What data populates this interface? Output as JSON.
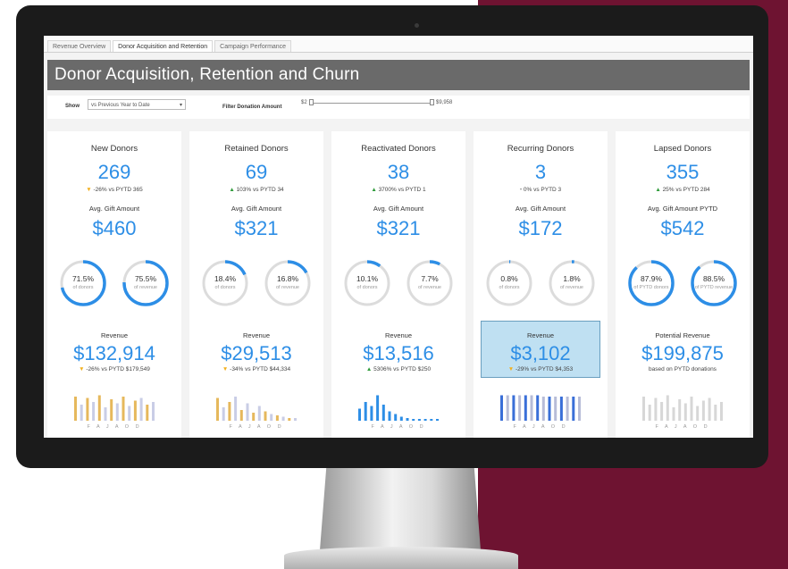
{
  "tabs": [
    "Revenue Overview",
    "Donor Acquisition and Retention",
    "Campaign Performance"
  ],
  "active_tab": 1,
  "header": {
    "title": "Donor Acquisition, Retention and Churn"
  },
  "filters": {
    "show_label": "Show",
    "show_value": "vs Previous Year to Date",
    "amount_label": "Filter Donation Amount",
    "amount_min": "$2",
    "amount_max": "$9,958"
  },
  "months": "F A J A O D",
  "colors": {
    "accent": "#2d8ee6",
    "up": "#2e9b3a",
    "down": "#f2b01e",
    "header": "#6a6a6a",
    "highlight": "#bfe0f2"
  },
  "cards": [
    {
      "title": "New Donors",
      "count": "269",
      "delta": {
        "dir": "down",
        "text": "-26% vs PYTD 365"
      },
      "gift_label": "Avg. Gift Amount",
      "gift": "$460",
      "donuts": [
        {
          "pct": 71.5,
          "value": "71.5%",
          "sub": "of donors"
        },
        {
          "pct": 75.5,
          "value": "75.5%",
          "sub": "of revenue"
        }
      ],
      "rev_label": "Revenue",
      "revenue": "$132,914",
      "rev_delta": {
        "dir": "down",
        "text": "-26% vs PYTD $179,549"
      },
      "bars": [
        0.9,
        0.6,
        0.85,
        0.7,
        0.95,
        0.5,
        0.8,
        0.65,
        0.9,
        0.55,
        0.75,
        0.85,
        0.6,
        0.7
      ],
      "bar_color": "#e6b85c",
      "bar_color2": "#c9cde6",
      "highlight": false
    },
    {
      "title": "Retained Donors",
      "count": "69",
      "delta": {
        "dir": "up",
        "text": "103% vs PYTD 34"
      },
      "gift_label": "Avg. Gift Amount",
      "gift": "$321",
      "donuts": [
        {
          "pct": 18.4,
          "value": "18.4%",
          "sub": "of donors"
        },
        {
          "pct": 16.8,
          "value": "16.8%",
          "sub": "of revenue"
        }
      ],
      "rev_label": "Revenue",
      "revenue": "$29,513",
      "rev_delta": {
        "dir": "down",
        "text": "-34% vs PYTD $44,334"
      },
      "bars": [
        0.85,
        0.5,
        0.7,
        0.9,
        0.4,
        0.65,
        0.3,
        0.55,
        0.35,
        0.25,
        0.2,
        0.15,
        0.1,
        0.1
      ],
      "bar_color": "#e6b85c",
      "bar_color2": "#c9cde6",
      "highlight": false
    },
    {
      "title": "Reactivated Donors",
      "count": "38",
      "delta": {
        "dir": "up",
        "text": "3700% vs PYTD 1"
      },
      "gift_label": "Avg. Gift Amount",
      "gift": "$321",
      "donuts": [
        {
          "pct": 10.1,
          "value": "10.1%",
          "sub": "of donors"
        },
        {
          "pct": 7.7,
          "value": "7.7%",
          "sub": "of revenue"
        }
      ],
      "rev_label": "Revenue",
      "revenue": "$13,516",
      "rev_delta": {
        "dir": "up",
        "text": "5306% vs PYTD $250"
      },
      "bars": [
        0.45,
        0.7,
        0.55,
        0.95,
        0.6,
        0.35,
        0.25,
        0.15,
        0.1,
        0.05,
        0.05,
        0.05,
        0.05,
        0.05
      ],
      "bar_color": "#2d8ee6",
      "bar_color2": "#2d8ee6",
      "highlight": false
    },
    {
      "title": "Recurring Donors",
      "count": "3",
      "delta": {
        "dir": "neu",
        "text": "0% vs PYTD 3"
      },
      "gift_label": "Avg. Gift Amount",
      "gift": "$172",
      "donuts": [
        {
          "pct": 0.8,
          "value": "0.8%",
          "sub": "of donors"
        },
        {
          "pct": 1.8,
          "value": "1.8%",
          "sub": "of revenue"
        }
      ],
      "rev_label": "Revenue",
      "revenue": "$3,102",
      "rev_delta": {
        "dir": "down",
        "text": "-29% vs PYTD $4,353"
      },
      "bars": [
        0.95,
        0.95,
        0.95,
        0.95,
        0.95,
        0.95,
        0.95,
        0.9,
        0.9,
        0.9,
        0.9,
        0.9,
        0.9,
        0.9
      ],
      "bar_color": "#3a6fd8",
      "bar_color2": "#b7bcd8",
      "highlight": true
    },
    {
      "title": "Lapsed Donors",
      "count": "355",
      "delta": {
        "dir": "up",
        "text": "25% vs PYTD 284"
      },
      "gift_label": "Avg. Gift Amount PYTD",
      "gift": "$542",
      "donuts": [
        {
          "pct": 87.9,
          "value": "87.9%",
          "sub": "of PYTD donors"
        },
        {
          "pct": 88.5,
          "value": "88.5%",
          "sub": "of PYTD revenue"
        }
      ],
      "rev_label": "Potential Revenue",
      "revenue": "$199,875",
      "rev_delta": {
        "dir": "none",
        "text": "based on PYTD donations"
      },
      "bars": [
        0.9,
        0.6,
        0.85,
        0.7,
        0.95,
        0.5,
        0.8,
        0.65,
        0.9,
        0.55,
        0.75,
        0.85,
        0.6,
        0.7
      ],
      "bar_color": "#d7d7d7",
      "bar_color2": "#d7d7d7",
      "highlight": false
    }
  ]
}
